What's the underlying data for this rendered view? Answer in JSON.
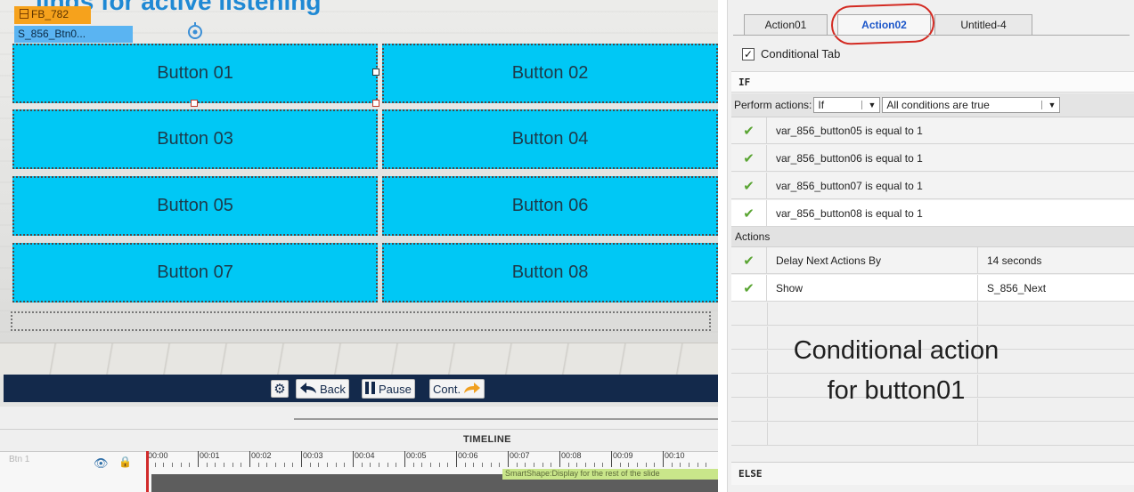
{
  "stage": {
    "heading": "lings for active listening",
    "fb_tag": "FB_782",
    "button_tag": "S_856_Btn0...",
    "buttons": [
      "Button 01",
      "Button 02",
      "Button 03",
      "Button 04",
      "Button 05",
      "Button 06",
      "Button 07",
      "Button 08"
    ],
    "button_color": "#00c8f5",
    "playbar": {
      "back": "Back",
      "pause": "Pause",
      "cont": "Cont."
    }
  },
  "timeline": {
    "title": "TIMELINE",
    "layer_label": "Btn 1",
    "ruler": [
      "00:00",
      "00:01",
      "00:02",
      "00:03",
      "00:04",
      "00:05",
      "00:06",
      "00:07",
      "00:08",
      "00:09",
      "00:10"
    ],
    "bar_label": "SmartShape:Display for the rest of the slide"
  },
  "panel": {
    "tabs": [
      "Action01",
      "Action02",
      "Untitled-4"
    ],
    "active_tab": "Action02",
    "conditional_tab_label": "Conditional Tab",
    "conditional_tab_checked": true,
    "if_label": "IF",
    "perform_label": "Perform actions:",
    "perform_select": "If",
    "conditions_select": "All conditions are true",
    "conditions": [
      "var_856_button05   is equal to   1",
      "var_856_button06   is equal to   1",
      "var_856_button07   is equal to   1",
      "var_856_button08   is equal to   1"
    ],
    "actions_label": "Actions",
    "actions": [
      {
        "action": "Delay Next Actions By",
        "value": "14   seconds"
      },
      {
        "action": "Show",
        "value": "S_856_Next"
      }
    ],
    "else_label": "ELSE"
  },
  "annotation": {
    "line1": "Conditional action",
    "line2": "for button01",
    "circle_color": "#d32a22"
  }
}
